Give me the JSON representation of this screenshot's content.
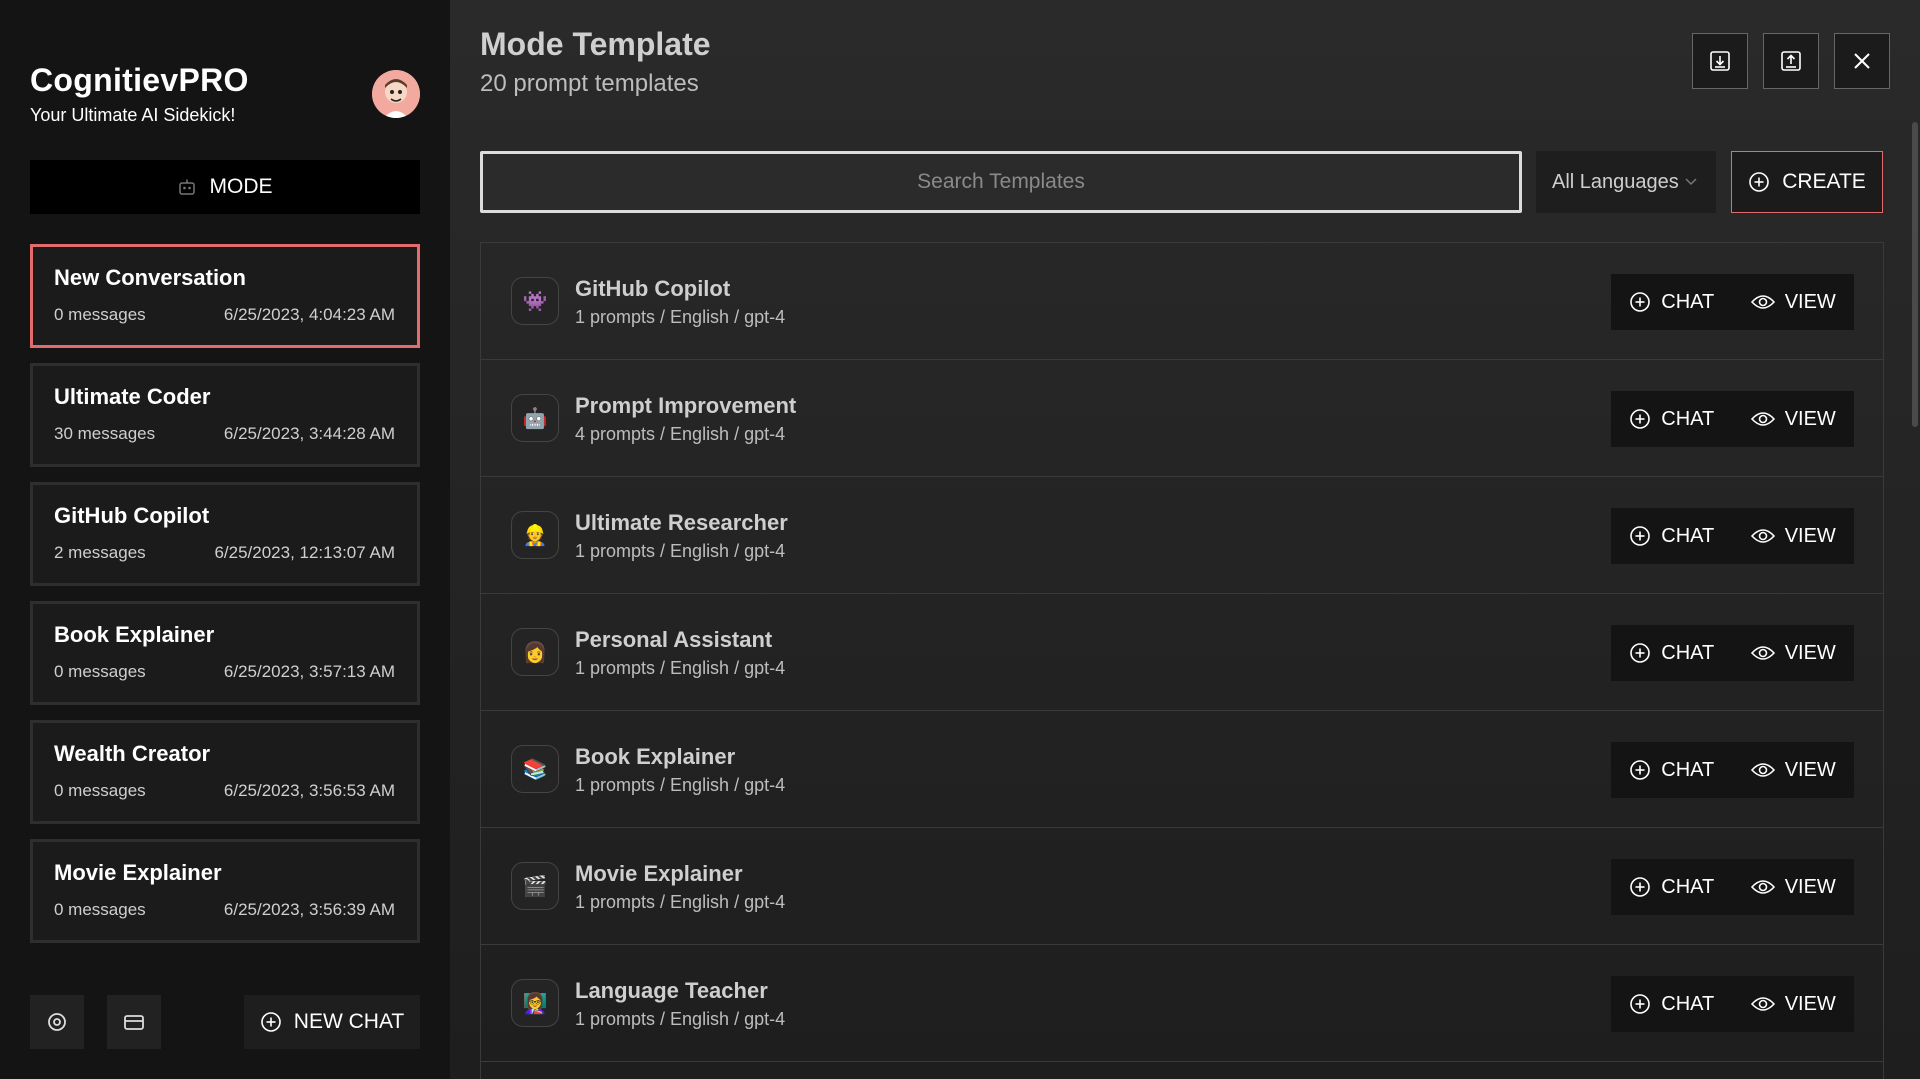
{
  "sidebar": {
    "brand_title": "CognitievPRO",
    "brand_subtitle": "Your Ultimate AI Sidekick!",
    "mode_label": "MODE",
    "conversations": [
      {
        "title": "New Conversation",
        "messages": "0 messages",
        "date": "6/25/2023, 4:04:23 AM",
        "active": true
      },
      {
        "title": "Ultimate Coder",
        "messages": "30 messages",
        "date": "6/25/2023, 3:44:28 AM"
      },
      {
        "title": "GitHub Copilot",
        "messages": "2 messages",
        "date": "6/25/2023, 12:13:07 AM"
      },
      {
        "title": "Book Explainer",
        "messages": "0 messages",
        "date": "6/25/2023, 3:57:13 AM"
      },
      {
        "title": "Wealth Creator",
        "messages": "0 messages",
        "date": "6/25/2023, 3:56:53 AM"
      },
      {
        "title": "Movie Explainer",
        "messages": "0 messages",
        "date": "6/25/2023, 3:56:39 AM"
      }
    ],
    "new_chat_label": "NEW CHAT"
  },
  "main": {
    "title": "Mode Template",
    "subtitle": "20 prompt templates",
    "search_placeholder": "Search Templates",
    "language_filter": "All Languages",
    "create_label": "CREATE",
    "chat_label": "CHAT",
    "view_label": "VIEW",
    "templates": [
      {
        "name": "GitHub Copilot",
        "meta": "1 prompts / English / gpt-4",
        "icon": "👾"
      },
      {
        "name": "Prompt Improvement",
        "meta": "4 prompts / English / gpt-4",
        "icon": "🤖"
      },
      {
        "name": "Ultimate Researcher",
        "meta": "1 prompts / English / gpt-4",
        "icon": "👷"
      },
      {
        "name": "Personal Assistant",
        "meta": "1 prompts / English / gpt-4",
        "icon": "👩"
      },
      {
        "name": "Book Explainer",
        "meta": "1 prompts / English / gpt-4",
        "icon": "📚"
      },
      {
        "name": "Movie Explainer",
        "meta": "1 prompts / English / gpt-4",
        "icon": "🎬"
      },
      {
        "name": "Language Teacher",
        "meta": "1 prompts / English / gpt-4",
        "icon": "👩‍🏫"
      }
    ]
  },
  "colors": {
    "accent": "#e36b6b",
    "sidebar_bg": "#141414",
    "main_bg": "#2a2a2a"
  }
}
